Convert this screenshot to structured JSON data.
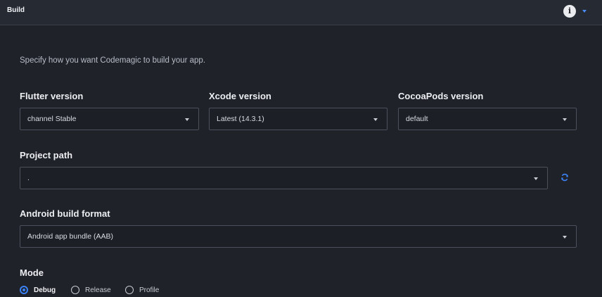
{
  "header": {
    "title": "Build",
    "info_icon": "i"
  },
  "intro": "Specify how you want Codemagic to build your app.",
  "fields": {
    "flutter_version": {
      "label": "Flutter version",
      "value": "channel Stable"
    },
    "xcode_version": {
      "label": "Xcode version",
      "value": "Latest (14.3.1)"
    },
    "cocoapods_version": {
      "label": "CocoaPods version",
      "value": "default"
    },
    "project_path": {
      "label": "Project path",
      "value": "."
    },
    "android_build_format": {
      "label": "Android build format",
      "value": "Android app bundle (AAB)"
    }
  },
  "mode": {
    "label": "Mode",
    "options": [
      "Debug",
      "Release",
      "Profile"
    ],
    "selected": "Debug"
  },
  "colors": {
    "accent": "#3b82f6",
    "background": "#1f2229",
    "header": "#262a33"
  }
}
